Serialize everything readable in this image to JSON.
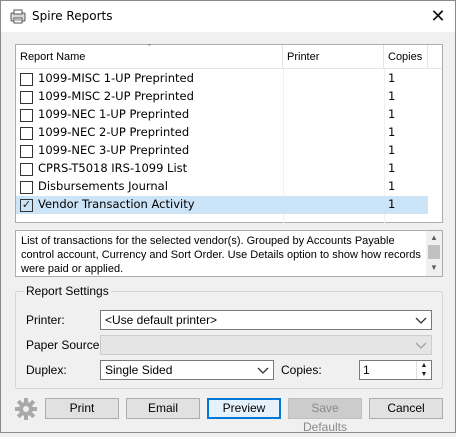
{
  "window": {
    "title": "Spire Reports",
    "close_glyph": "✕"
  },
  "reports_list": {
    "columns": [
      "Report Name",
      "Printer",
      "Copies"
    ],
    "rows": [
      {
        "checked": false,
        "name": "1099-MISC 1-UP Preprinted",
        "printer": "",
        "copies": "1"
      },
      {
        "checked": false,
        "name": "1099-MISC 2-UP Preprinted",
        "printer": "",
        "copies": "1"
      },
      {
        "checked": false,
        "name": "1099-NEC 1-UP Preprinted",
        "printer": "",
        "copies": "1"
      },
      {
        "checked": false,
        "name": "1099-NEC 2-UP Preprinted",
        "printer": "",
        "copies": "1"
      },
      {
        "checked": false,
        "name": "1099-NEC 3-UP Preprinted",
        "printer": "",
        "copies": "1"
      },
      {
        "checked": false,
        "name": "CPRS-T5018 IRS-1099 List",
        "printer": "",
        "copies": "1"
      },
      {
        "checked": false,
        "name": "Disbursements Journal",
        "printer": "",
        "copies": "1"
      },
      {
        "checked": true,
        "name": "Vendor Transaction Activity",
        "printer": "",
        "copies": "1"
      }
    ],
    "selected_index": 7
  },
  "description": {
    "text": "List of transactions for the selected vendor(s). Grouped by Accounts Payable control account, Currency and Sort Order. Use Details option to show how records were paid or applied."
  },
  "report_settings": {
    "group_title": "Report Settings",
    "printer_label": "Printer:",
    "printer_value": "<Use default printer>",
    "paper_source_label": "Paper Source:",
    "paper_source_value": "",
    "duplex_label": "Duplex:",
    "duplex_value": "Single Sided",
    "copies_label": "Copies:",
    "copies_value": "1"
  },
  "buttons": {
    "print": "Print",
    "email": "Email",
    "preview": "Preview",
    "save_defaults": "Save Defaults",
    "cancel": "Cancel"
  },
  "icons": {
    "app": "report-window-icon",
    "settings": "gear-icon",
    "selected_accent": "#cce4f7",
    "default_button_accent": "#0078d7"
  }
}
